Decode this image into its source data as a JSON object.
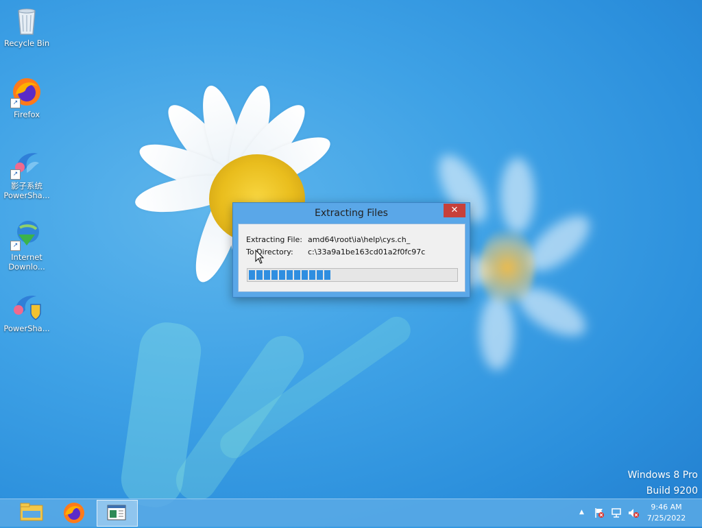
{
  "desktop": {
    "icons": [
      {
        "label": "Recycle Bin",
        "icon": "recycle-bin-icon"
      },
      {
        "label": "Firefox",
        "icon": "firefox-icon"
      },
      {
        "label": "影子系统\nPowerSha...",
        "line1": "影子系统",
        "line2": "PowerSha...",
        "icon": "powershadow-icon"
      },
      {
        "line1": "Internet",
        "line2": "Downlo...",
        "icon": "internet-download-manager-icon"
      },
      {
        "label": "PowerSha...",
        "icon": "powershadow-shield-icon"
      }
    ],
    "watermark": {
      "line1": "Windows 8 Pro",
      "line2": "Build 9200"
    }
  },
  "dialog": {
    "title": "Extracting Files",
    "close_label": "✕",
    "file_label": "Extracting File:",
    "file_value": "amd64\\root\\ia\\help\\cys.ch_",
    "dir_label": "To Directory:",
    "dir_value": "c:\\33a9a1be163cd01a2f0fc97c",
    "progress_fraction": 0.39
  },
  "taskbar": {
    "buttons": [
      {
        "name": "file-explorer",
        "icon": "folder-icon"
      },
      {
        "name": "firefox",
        "icon": "firefox-icon"
      },
      {
        "name": "extractor-window",
        "icon": "window-icon",
        "active": true
      }
    ],
    "tray": {
      "show_hidden": "▲",
      "icons": [
        "action-center-flag-icon",
        "network-icon",
        "volume-muted-icon"
      ]
    },
    "clock": {
      "time": "9:46 AM",
      "date": "7/25/2022"
    }
  }
}
